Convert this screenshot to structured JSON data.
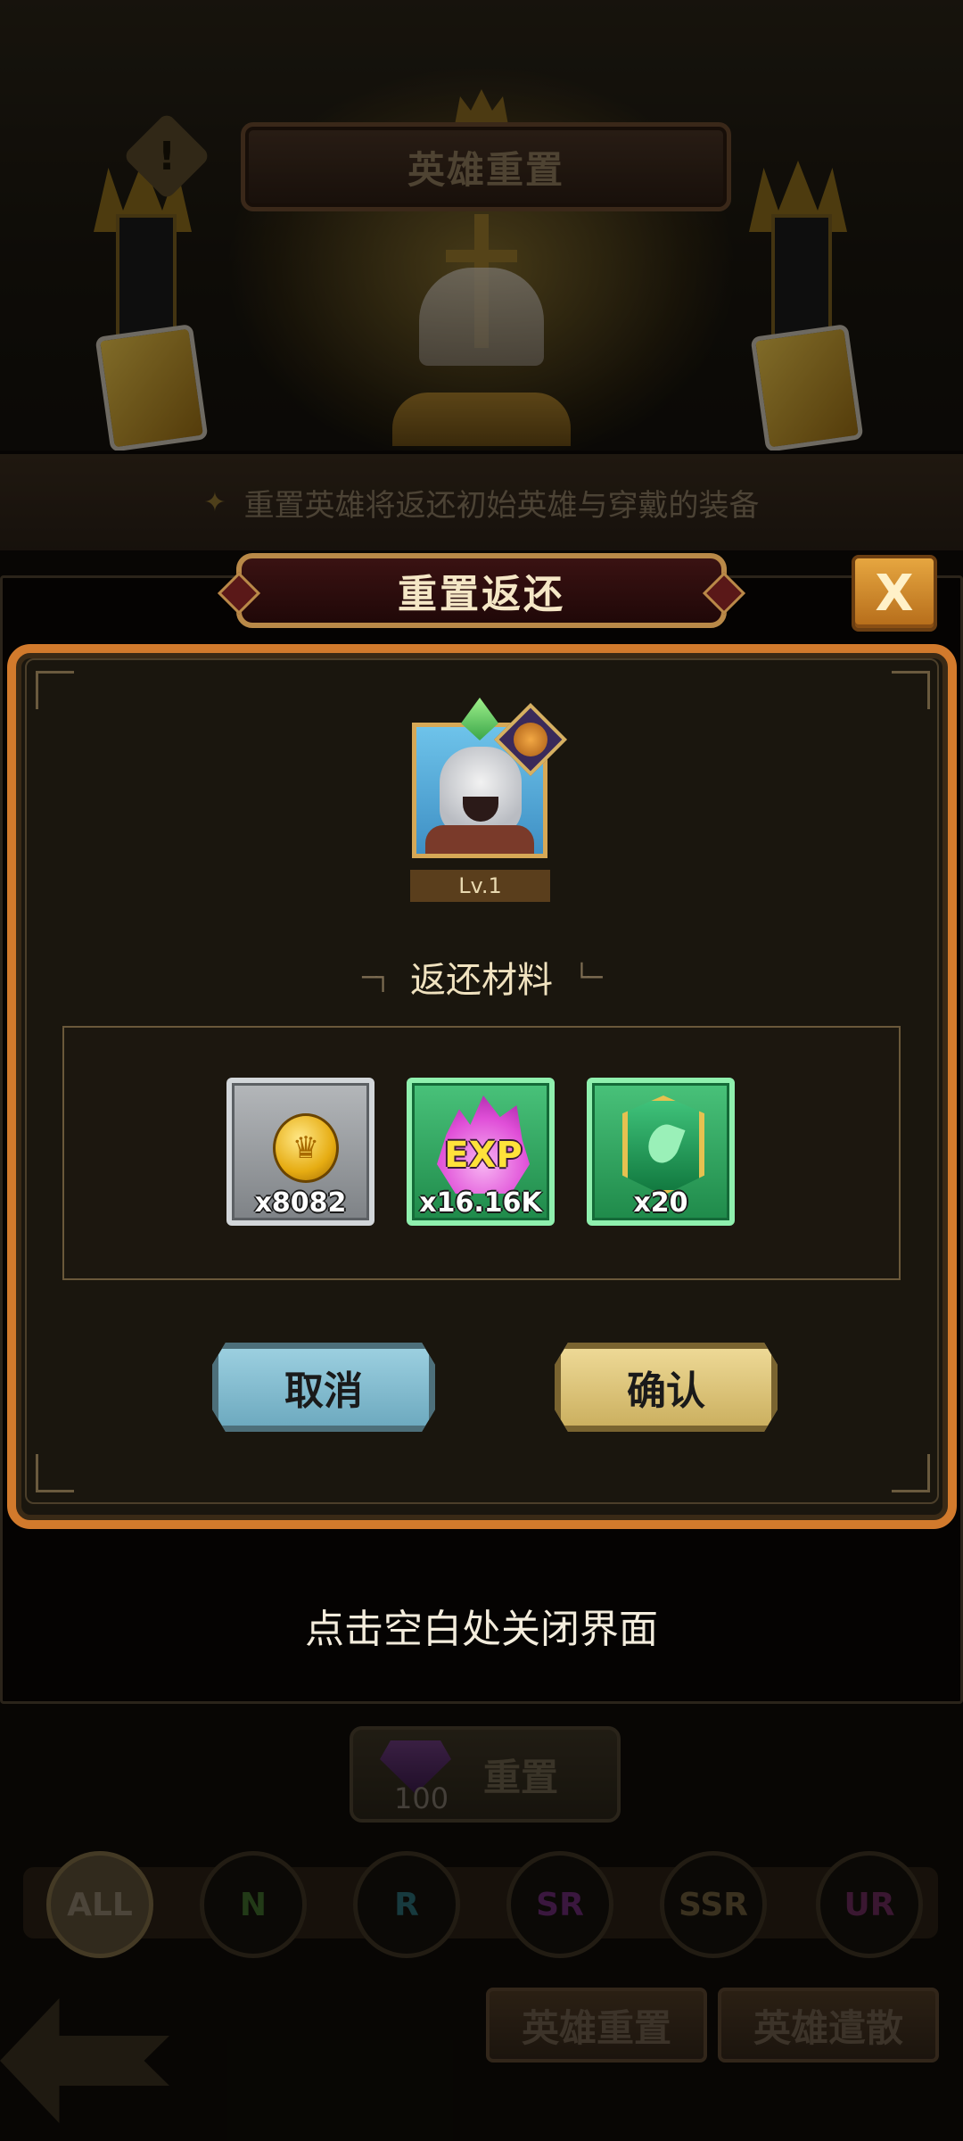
{
  "background": {
    "title": "英雄重置",
    "warning_icon": "!",
    "description": "重置英雄将返还初始英雄与穿戴的装备",
    "reset_button": {
      "label": "重置",
      "cost": "100",
      "icon": "purple-gem-icon"
    },
    "filters": [
      "ALL",
      "N",
      "R",
      "SR",
      "SSR",
      "UR"
    ],
    "filter_colors": {
      "N": "#3e6a2a",
      "R": "#2a6a72",
      "SR": "#6a2a72",
      "SSR": "#6a5a3a",
      "UR": "#6a2a5a"
    },
    "active_filter": "ALL",
    "tabs": [
      "英雄重置",
      "英雄遣散"
    ]
  },
  "modal": {
    "title": "重置返还",
    "close_icon": "X",
    "hero": {
      "level": "Lv.1"
    },
    "section_title": "返还材料",
    "section_deco_left": "─┐",
    "section_deco_right": "└─",
    "materials": [
      {
        "name": "gold-coin",
        "icon": "coin-icon",
        "quantity": "x8082",
        "frame": "gray"
      },
      {
        "name": "exp",
        "icon_text": "EXP",
        "quantity": "x16.16K",
        "frame": "green"
      },
      {
        "name": "emblem",
        "icon": "green-emblem-icon",
        "quantity": "x20",
        "frame": "green"
      }
    ],
    "cancel_label": "取消",
    "confirm_label": "确认"
  },
  "hint": "点击空白处关闭界面"
}
